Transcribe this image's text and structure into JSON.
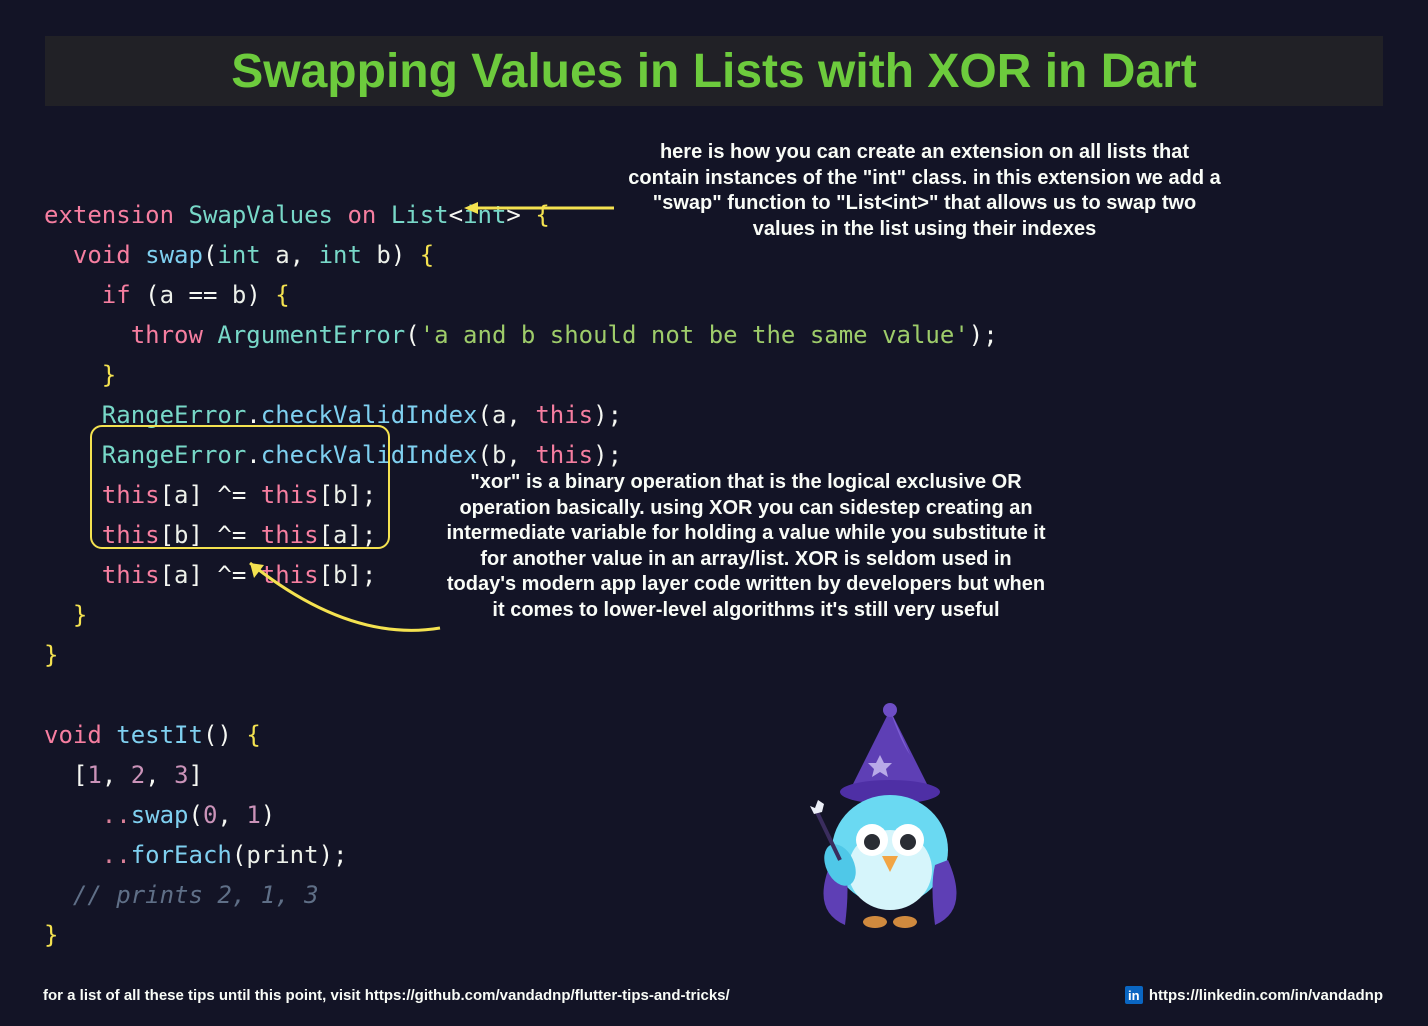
{
  "title": "Swapping Values in Lists with XOR in Dart",
  "annotations": {
    "top": "here is how you can create an extension on all lists that contain instances of the \"int\" class. in this extension we add a \"swap\" function to \"List<int>\" that allows us to swap two values in the list using their indexes",
    "mid": "\"xor\" is a binary operation that is the logical exclusive OR operation basically. using XOR you can sidestep creating an intermediate variable for holding a value while you substitute it for another value in an array/list. XOR is seldom used in today's modern app layer code written by developers but when it comes to lower-level algorithms it's still very useful"
  },
  "code": {
    "line1": {
      "kw_extension": "extension",
      "type_SwapValues": "SwapValues",
      "kw_on": "on",
      "type_List": "List",
      "lt": "<",
      "type_int": "int",
      "gt": ">",
      "brace": "{"
    },
    "line2": {
      "kw_void": "void",
      "fn_swap": "swap",
      "paren_o": "(",
      "type_int1": "int",
      "id_a": "a",
      "comma": ",",
      "type_int2": "int",
      "id_b": "b",
      "paren_c": ")",
      "brace": "{"
    },
    "line3": {
      "kw_if": "if",
      "paren_o": "(",
      "id_a": "a",
      "op": "==",
      "id_b": "b",
      "paren_c": ")",
      "brace": "{"
    },
    "line4": {
      "kw_throw": "throw",
      "type_AE": "ArgumentError",
      "paren_o": "(",
      "str": "'a and b should not be the same value'",
      "paren_c": ")",
      "semi": ";"
    },
    "line5": {
      "brace": "}"
    },
    "line6": {
      "type_RE": "RangeError",
      "dot": ".",
      "fn": "checkValidIndex",
      "paren_o": "(",
      "id_a": "a",
      "comma": ",",
      "kw_this": "this",
      "paren_c": ")",
      "semi": ";"
    },
    "line7": {
      "type_RE": "RangeError",
      "dot": ".",
      "fn": "checkValidIndex",
      "paren_o": "(",
      "id_b": "b",
      "comma": ",",
      "kw_this": "this",
      "paren_c": ")",
      "semi": ";"
    },
    "line8": {
      "kw_this1": "this",
      "br_o1": "[",
      "id_a1": "a",
      "br_c1": "]",
      "op": "^=",
      "kw_this2": "this",
      "br_o2": "[",
      "id_b1": "b",
      "br_c2": "]",
      "semi": ";"
    },
    "line9": {
      "kw_this1": "this",
      "br_o1": "[",
      "id_b1": "b",
      "br_c1": "]",
      "op": "^=",
      "kw_this2": "this",
      "br_o2": "[",
      "id_a1": "a",
      "br_c2": "]",
      "semi": ";"
    },
    "line10": {
      "kw_this1": "this",
      "br_o1": "[",
      "id_a1": "a",
      "br_c1": "]",
      "op": "^=",
      "kw_this2": "this",
      "br_o2": "[",
      "id_b1": "b",
      "br_c2": "]",
      "semi": ";"
    },
    "line11": {
      "brace": "}"
    },
    "line12": {
      "brace": "}"
    },
    "line13": {
      "kw_void": "void",
      "fn": "testIt",
      "paren_o": "(",
      "paren_c": ")",
      "brace": "{"
    },
    "line14": {
      "br_o": "[",
      "n1": "1",
      "c1": ",",
      "n2": "2",
      "c2": ",",
      "n3": "3",
      "br_c": "]"
    },
    "line15": {
      "casc": "..",
      "fn": "swap",
      "paren_o": "(",
      "n0": "0",
      "comma": ",",
      "n1": "1",
      "paren_c": ")"
    },
    "line16": {
      "casc": "..",
      "fn": "forEach",
      "paren_o": "(",
      "id": "print",
      "paren_c": ")",
      "semi": ";"
    },
    "line17": {
      "comment": "// prints 2, 1, 3"
    },
    "line18": {
      "brace": "}"
    }
  },
  "footer": {
    "left": "for a list of all these tips until this point, visit https://github.com/vandadnp/flutter-tips-and-tricks/",
    "right": "https://linkedin.com/in/vandadnp",
    "linkedin_glyph": "in"
  },
  "icons": {
    "arrow_color": "#F4E250"
  }
}
